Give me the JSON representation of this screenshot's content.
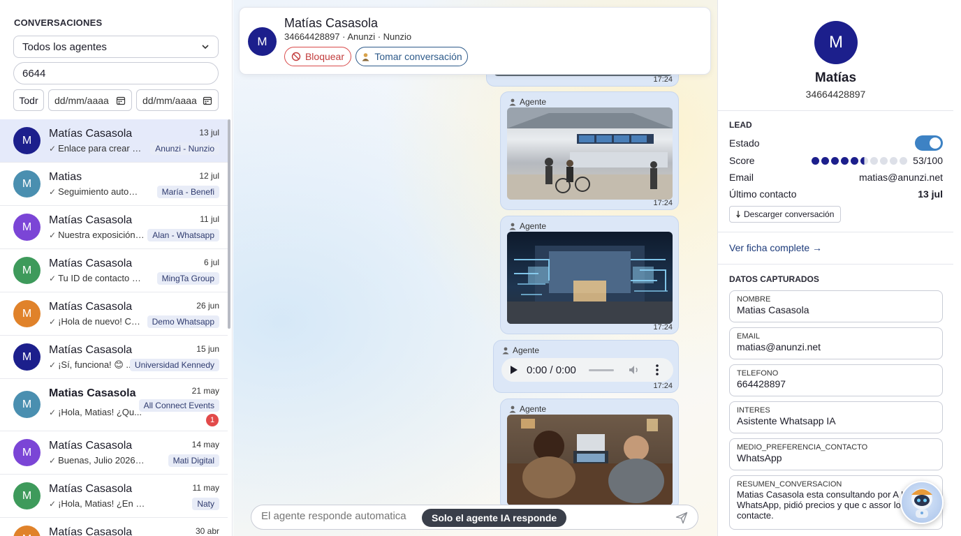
{
  "left": {
    "heading": "CONVERSACIONES",
    "agent_select": "Todos los agentes",
    "search_value": "6644",
    "todr_label": "Todr",
    "date_from_placeholder": "dd/mm/aaaa",
    "date_to_placeholder": "dd/mm/aaaa",
    "conversations": [
      {
        "initial": "M",
        "name": "Matías Casasola",
        "date": "13 jul",
        "preview": "Enlace para crear un...",
        "tag": "Anunzi - Nunzio",
        "color": "#1c1f8c"
      },
      {
        "initial": "M",
        "name": "Matias",
        "date": "12 jul",
        "preview": "Seguimiento automáti...",
        "tag": "María - Benefi",
        "color": "#4a8fb0"
      },
      {
        "initial": "M",
        "name": "Matías Casasola",
        "date": "11 jul",
        "preview": "Nuestra exposición f...",
        "tag": "Alan - Whatsapp",
        "color": "#7b45d6"
      },
      {
        "initial": "M",
        "name": "Matías Casasola",
        "date": "6 jul",
        "preview": "Tu ID de contacto en e...",
        "tag": "MingTa Group",
        "color": "#3e9a5b"
      },
      {
        "initial": "M",
        "name": "Matías Casasola",
        "date": "26 jun",
        "preview": "¡Hola de nuevo! Con...",
        "tag": "Demo Whatsapp",
        "color": "#e0822a"
      },
      {
        "initial": "M",
        "name": "Matías Casasola",
        "date": "15 jun",
        "preview": "¡Sí, funciona! 😊 ...",
        "tag": "Universidad Kennedy",
        "color": "#1c1f8c"
      },
      {
        "initial": "M",
        "name": "Matias Casasola",
        "date": "21 may",
        "preview": "¡Hola, Matias! ¿Qu...",
        "tag": "All Connect Events",
        "color": "#4a8fb0",
        "unread": "1",
        "bold": true
      },
      {
        "initial": "M",
        "name": "Matías Casasola",
        "date": "14 may",
        "preview": "Buenas, Julio 2026 tiene ...",
        "tag": "Mati Digital",
        "color": "#7b45d6"
      },
      {
        "initial": "M",
        "name": "Matías Casasola",
        "date": "11 may",
        "preview": "¡Hola, Matias! ¿En que puedo a...",
        "tag": "Naty",
        "color": "#3e9a5b"
      },
      {
        "initial": "M",
        "name": "Matías Casasola",
        "date": "30 abr",
        "preview": "",
        "tag": "",
        "color": "#e0822a"
      }
    ]
  },
  "chat": {
    "avatar_initial": "M",
    "name": "Matías Casasola",
    "subtitle": "34664428897 · Anunzi · Nunzio",
    "block_label": "Bloquear",
    "take_label": "Tomar conversación",
    "messages": [
      {
        "who": "",
        "time": "17:24"
      },
      {
        "who": "Agente",
        "time": "17:24"
      },
      {
        "who": "Agente",
        "time": "17:24"
      },
      {
        "who": "Agente",
        "time": "17:24",
        "audio_time": "0:00 / 0:00"
      },
      {
        "who": "Agente",
        "time": ""
      }
    ],
    "composer_placeholder": "El agente responde automatica",
    "ia_pill": "Solo el agente IA responde"
  },
  "profile": {
    "initial": "M",
    "name": "Matías",
    "phone": "34664428897",
    "lead_heading": "LEAD",
    "estado_label": "Estado",
    "score_label": "Score",
    "score_value": "53/100",
    "score_fraction": 0.53,
    "email_label": "Email",
    "email_value": "matias@anunzi.net",
    "last_contact_label": "Último contacto",
    "last_contact_value": "13 jul",
    "download_label": "Descarger conversación",
    "view_link": "Ver ficha complete →",
    "captured_heading": "DATOS CAPTURADOS",
    "fields": [
      {
        "key": "NOMBRE",
        "value": "Matias Casasola"
      },
      {
        "key": "EMAIL",
        "value": "matias@anunzi.net"
      },
      {
        "key": "TELEFONO",
        "value": "664428897"
      },
      {
        "key": "INTERES",
        "value": "Asistente Whatsapp IA"
      },
      {
        "key": "MEDIO_PREFERENCIA_CONTACTO",
        "value": "WhatsApp"
      },
      {
        "key": "RESUMEN_CONVERSACION",
        "value": "Matias Casasola esta consultando por A IA para WhatsApp, pidió precios y que c assor lo contacte."
      }
    ]
  }
}
